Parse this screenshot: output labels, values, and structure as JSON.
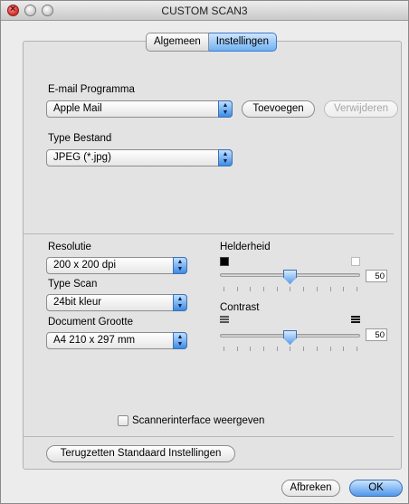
{
  "window": {
    "title": "CUSTOM SCAN3"
  },
  "tabs": [
    {
      "label": "Algemeen",
      "selected": false
    },
    {
      "label": "Instellingen",
      "selected": true
    }
  ],
  "email": {
    "label": "E-mail Programma",
    "value": "Apple Mail",
    "add_button": "Toevoegen",
    "remove_button": "Verwijderen"
  },
  "filetype": {
    "label": "Type Bestand",
    "value": "JPEG (*.jpg)"
  },
  "resolution": {
    "label": "Resolutie",
    "value": "200 x 200 dpi"
  },
  "scantype": {
    "label": "Type Scan",
    "value": "24bit kleur"
  },
  "docsize": {
    "label": "Document Grootte",
    "value": "A4  210 x 297 mm"
  },
  "brightness": {
    "label": "Helderheid",
    "value": "50",
    "level": 0.5
  },
  "contrast": {
    "label": "Contrast",
    "value": "50",
    "level": 0.5
  },
  "scanner_ui": {
    "label": "Scannerinterface weergeven",
    "checked": false
  },
  "reset_button": "Terugzetten Standaard Instellingen",
  "cancel_button": "Afbreken",
  "ok_button": "OK"
}
